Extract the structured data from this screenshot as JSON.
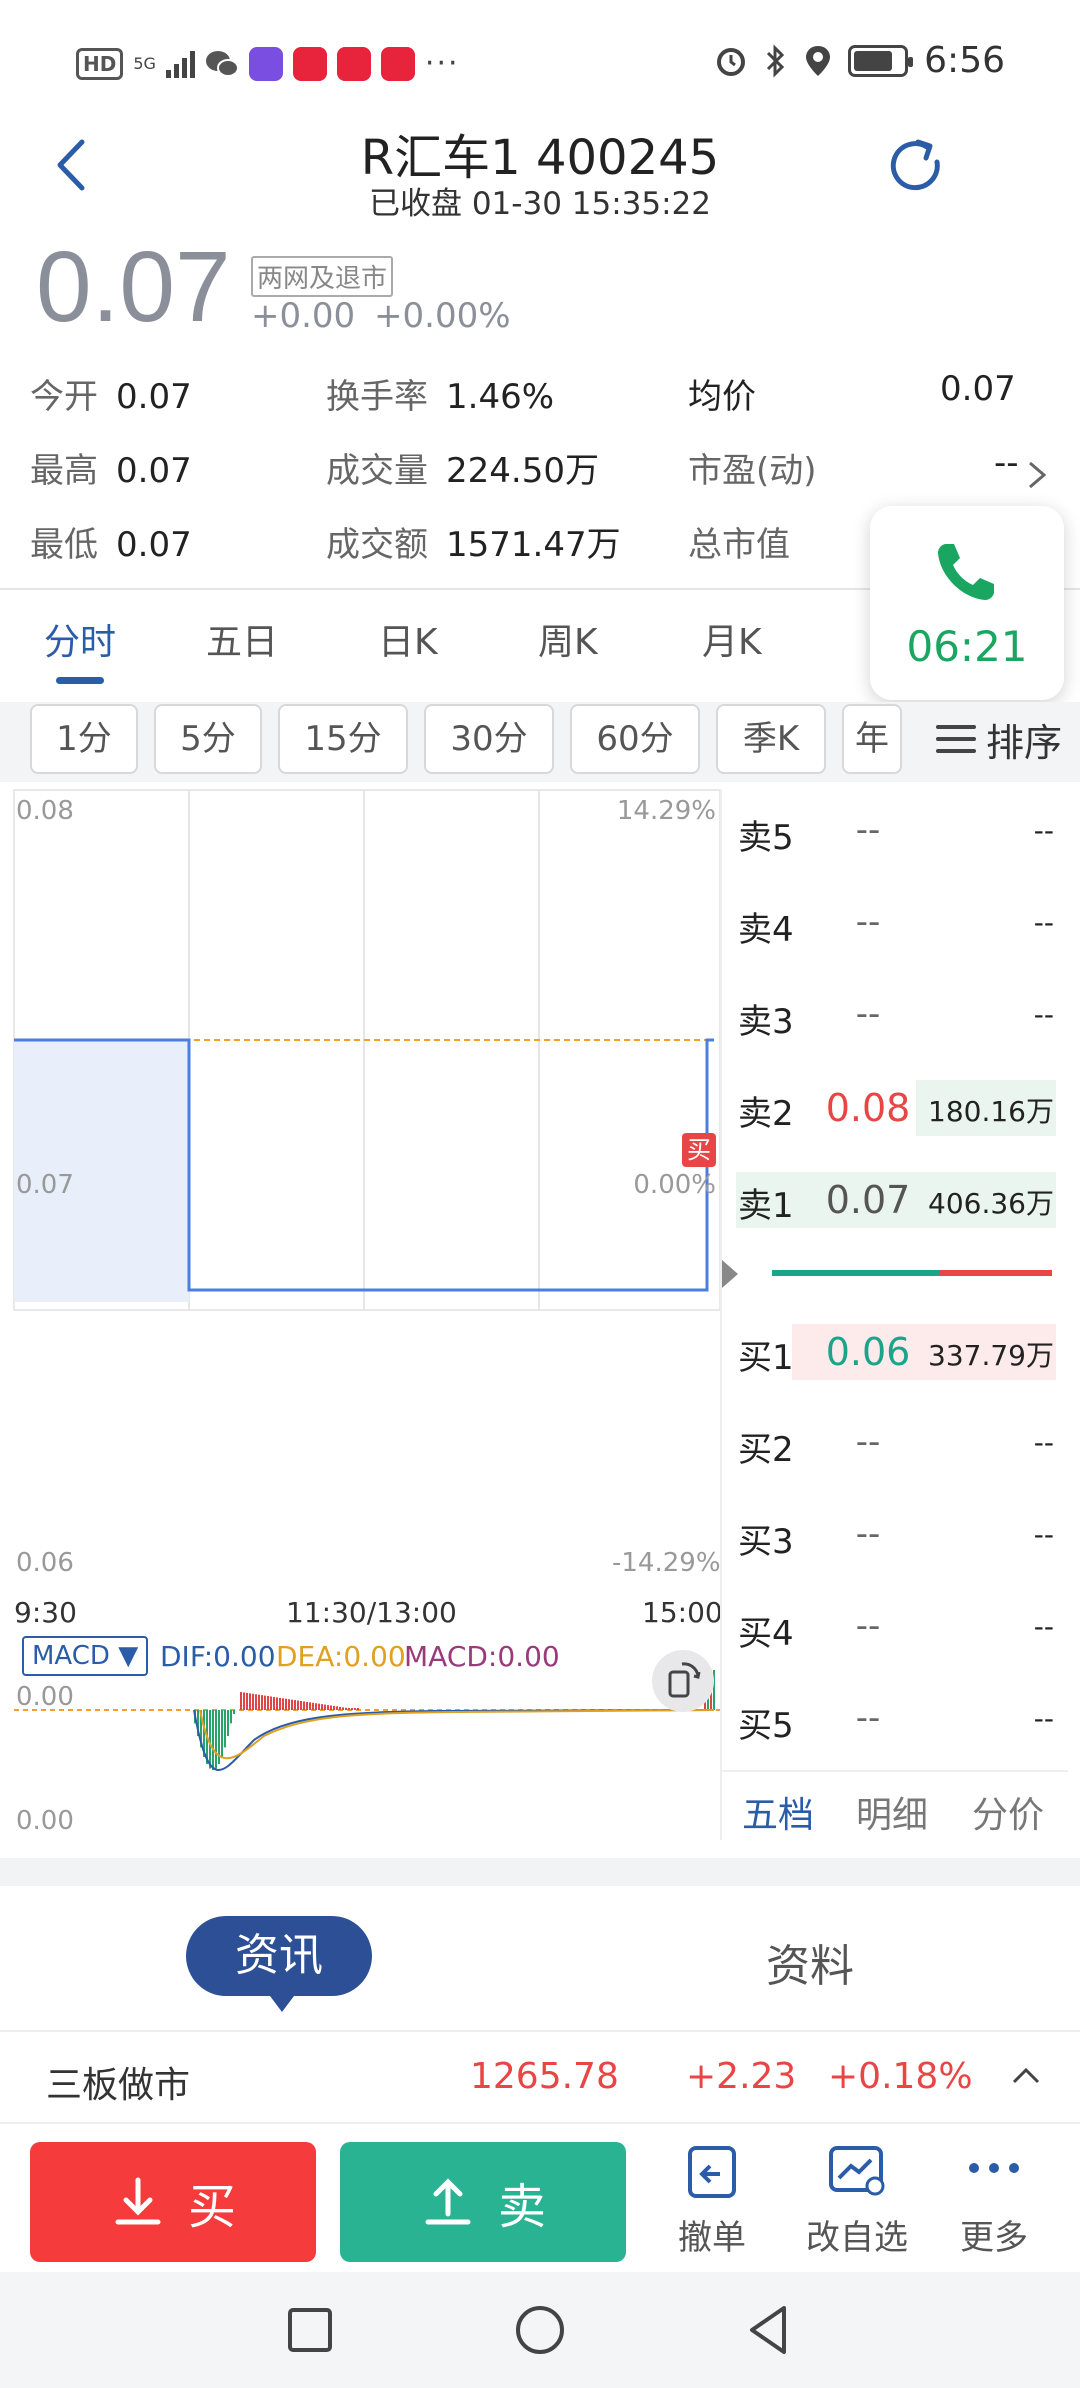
{
  "status_bar": {
    "hd": "HD",
    "signal": "5G",
    "more": "···",
    "time": "6:56",
    "icons": [
      "hd-icon",
      "signal-icon",
      "wechat-icon",
      "app-icon",
      "douyin-icon",
      "alarm-icon",
      "bluetooth-icon",
      "location-icon",
      "battery-icon"
    ]
  },
  "header": {
    "title": "R汇车1 400245",
    "subtitle": "已收盘 01-30 15:35:22"
  },
  "price": {
    "current": "0.07",
    "tag": "两网及退市",
    "change": "+0.00",
    "change_pct": "+0.00%"
  },
  "quote": {
    "open": {
      "label": "今开",
      "value": "0.07"
    },
    "high": {
      "label": "最高",
      "value": "0.07"
    },
    "low": {
      "label": "最低",
      "value": "0.07"
    },
    "turnover": {
      "label": "换手率",
      "value": "1.46%"
    },
    "volume": {
      "label": "成交量",
      "value": "224.50万"
    },
    "amount": {
      "label": "成交额",
      "value": "1571.47万"
    },
    "avg": {
      "label": "均价",
      "value": "0.07"
    },
    "pe": {
      "label": "市盈(动)",
      "value": "--"
    },
    "mktcap": {
      "label": "总市值",
      "value": ""
    }
  },
  "call_widget": {
    "timer": "06:21"
  },
  "main_tabs": [
    "分时",
    "五日",
    "日K",
    "周K",
    "月K"
  ],
  "periods": [
    "1分",
    "5分",
    "15分",
    "30分",
    "60分",
    "季K",
    "年"
  ],
  "sort_label": "排序",
  "chart_data": {
    "type": "line",
    "x_labels": [
      "9:30",
      "11:30/13:00",
      "15:00"
    ],
    "y_left": [
      "0.08",
      "0.07",
      "0.06"
    ],
    "y_right": [
      "14.29%",
      "0.00%",
      "-14.29%"
    ],
    "ylim": [
      0.06,
      0.08
    ],
    "prev_close": 0.07,
    "series": [
      {
        "values": [
          {
            "t": 0.0,
            "v": 0.07
          },
          {
            "t": 0.25,
            "v": 0.07
          },
          {
            "t": 0.25,
            "v": 0.06
          },
          {
            "t": 0.99,
            "v": 0.06
          },
          {
            "t": 0.99,
            "v": 0.07
          },
          {
            "t": 1.0,
            "v": 0.07
          }
        ]
      }
    ],
    "buy_marker": "买"
  },
  "macd": {
    "selector": "MACD ▼",
    "dif": "DIF:0.00",
    "dea": "DEA:0.00",
    "macd": "MACD:0.00",
    "top": "0.00",
    "bottom": "0.00"
  },
  "order_book": {
    "sells": [
      {
        "label": "卖5",
        "price": "--",
        "vol": "--"
      },
      {
        "label": "卖4",
        "price": "--",
        "vol": "--"
      },
      {
        "label": "卖3",
        "price": "--",
        "vol": "--"
      },
      {
        "label": "卖2",
        "price": "0.08",
        "vol": "180.16万"
      },
      {
        "label": "卖1",
        "price": "0.07",
        "vol": "406.36万"
      }
    ],
    "buys": [
      {
        "label": "买1",
        "price": "0.06",
        "vol": "337.79万"
      },
      {
        "label": "买2",
        "price": "--",
        "vol": "--"
      },
      {
        "label": "买3",
        "price": "--",
        "vol": "--"
      },
      {
        "label": "买4",
        "price": "--",
        "vol": "--"
      },
      {
        "label": "买5",
        "price": "--",
        "vol": "--"
      }
    ],
    "tabs": [
      "五档",
      "明细",
      "分价"
    ]
  },
  "info_tabs": {
    "active": "资讯",
    "other": "资料"
  },
  "index_bar": {
    "name": "三板做市",
    "value": "1265.78",
    "change": "+2.23",
    "pct": "+0.18%"
  },
  "actions": {
    "buy": "买",
    "sell": "卖",
    "cancel": "撤单",
    "watchlist": "改自选",
    "more": "更多"
  },
  "colors": {
    "accent": "#2b5ca8",
    "red": "#e84545",
    "green": "#1aa58a",
    "buy_btn": "#f53b3b",
    "sell_btn": "#2ab393"
  }
}
